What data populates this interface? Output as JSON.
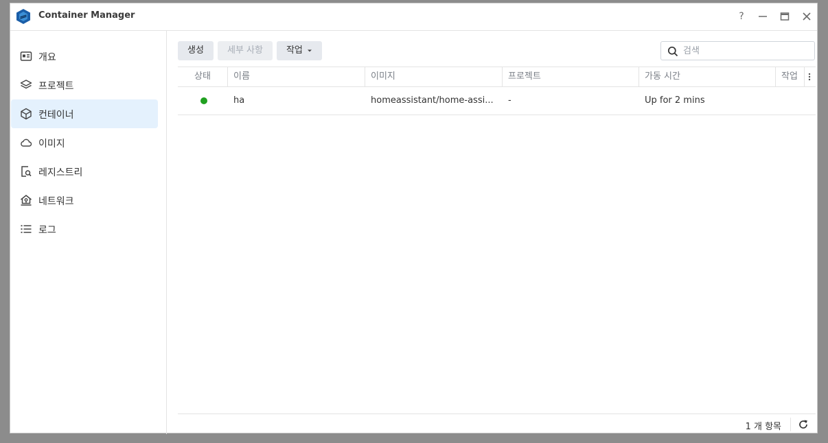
{
  "window": {
    "title": "Container Manager",
    "controls": {
      "help": "?",
      "minimize": "—",
      "maximize": "□",
      "close": "✕"
    }
  },
  "sidebar": {
    "items": [
      {
        "label": "개요",
        "icon": "overview-icon",
        "active": false
      },
      {
        "label": "프로젝트",
        "icon": "layers-icon",
        "active": false
      },
      {
        "label": "컨테이너",
        "icon": "cube-icon",
        "active": true
      },
      {
        "label": "이미지",
        "icon": "cloud-icon",
        "active": false
      },
      {
        "label": "레지스트리",
        "icon": "registry-search-icon",
        "active": false
      },
      {
        "label": "네트워크",
        "icon": "network-home-icon",
        "active": false
      },
      {
        "label": "로그",
        "icon": "list-icon",
        "active": false
      }
    ]
  },
  "toolbar": {
    "create_label": "생성",
    "details_label": "세부 사항",
    "action_label": "작업",
    "search_placeholder": "검색"
  },
  "table": {
    "columns": [
      "상태",
      "이름",
      "이미지",
      "프로젝트",
      "가동 시간",
      "작업"
    ],
    "rows": [
      {
        "status": "running",
        "name": "ha",
        "image": "homeassistant/home-assi...",
        "project": "-",
        "uptime": "Up for 2 mins",
        "action": ""
      }
    ]
  },
  "footer": {
    "count_label": "1 개 항목"
  },
  "colors": {
    "accent": "#e4f1fd",
    "running": "#20a020",
    "brand": "#1a5ea8"
  }
}
